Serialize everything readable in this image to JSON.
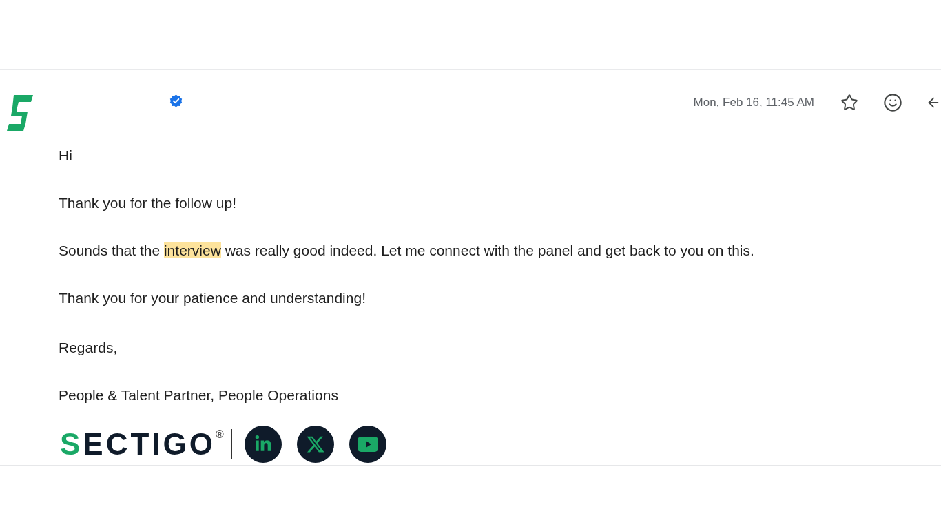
{
  "sender": {
    "verified": true
  },
  "date": "Mon, Feb 16, 11:45 AM",
  "starred": false,
  "greeting": "Hi",
  "paragraphs": [
    [
      {
        "text": "Thank you for the follow up!",
        "highlighted": false
      }
    ],
    [
      {
        "text": "Sounds that the ",
        "highlighted": false
      },
      {
        "text": "interview",
        "highlighted": true
      },
      {
        "text": " was really good indeed. Let me connect with the panel and get back to you on this.",
        "highlighted": false
      }
    ],
    [
      {
        "text": "Thank you for your patience and understanding!",
        "highlighted": false
      }
    ]
  ],
  "signature": {
    "closing": "Regards,",
    "title": "People & Talent Partner, People Operations"
  },
  "footer": {
    "logo_text": "SECTIGO",
    "registered_mark": "®",
    "social": [
      {
        "kind": "linkedin"
      },
      {
        "kind": "x"
      },
      {
        "kind": "youtube"
      }
    ]
  }
}
